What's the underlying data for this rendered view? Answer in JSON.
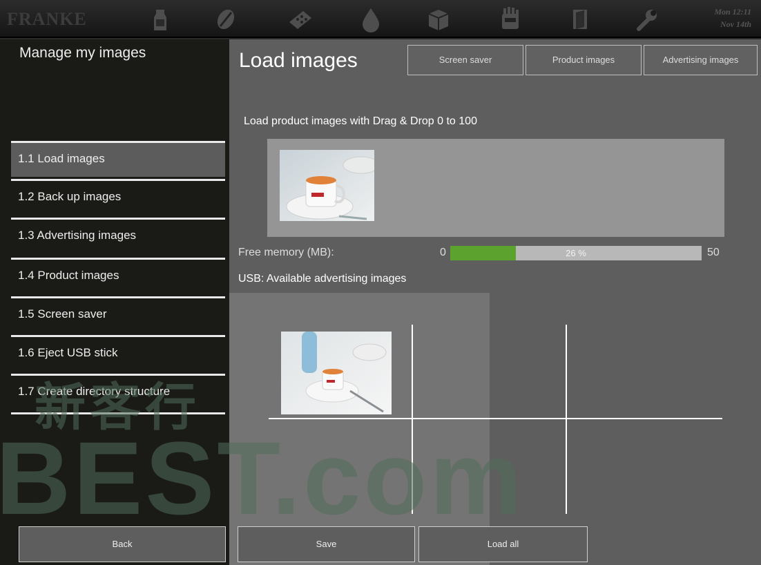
{
  "header": {
    "logo_text": "FRANKE",
    "icons": [
      "milk-icon",
      "coffee-bean-icon",
      "pastry-icon",
      "water-drop-icon",
      "box-icon",
      "cleaning-hand-icon",
      "door-icon",
      "wrench-icon"
    ],
    "clock": {
      "time": "Mon 12:11",
      "date": "Nov 14th"
    }
  },
  "sidebar": {
    "title": "Manage my images",
    "items": [
      {
        "label": "1.1 Load images",
        "active": true
      },
      {
        "label": "1.2 Back up images",
        "active": false
      },
      {
        "label": "1.3 Advertising images",
        "active": false
      },
      {
        "label": "1.4 Product images",
        "active": false
      },
      {
        "label": "1.5 Screen saver",
        "active": false
      },
      {
        "label": "1.6 Eject USB stick",
        "active": false
      },
      {
        "label": "1.7  Create directory structure",
        "active": false
      }
    ],
    "back_label": "Back"
  },
  "main": {
    "title": "Load images",
    "tabs": [
      {
        "label": "Screen saver"
      },
      {
        "label": "Product images"
      },
      {
        "label": "Advertising images"
      }
    ],
    "drag_label": "Load product images with Drag & Drop 0 to 100",
    "memory": {
      "label": "Free memory (MB):",
      "min": "0",
      "max": "50",
      "percent_text": "26 %",
      "fraction": 0.26
    },
    "usb_label": "USB: Available advertising images",
    "save_label": "Save",
    "load_all_label": "Load all"
  },
  "watermark": {
    "line1": "新客行",
    "line2": "BEST.com"
  },
  "colors": {
    "progress": "#5ba22e",
    "active_item": "#5c5c5c",
    "main_bg": "#5e5e5e",
    "sidebar_bg": "#1a1a17"
  }
}
